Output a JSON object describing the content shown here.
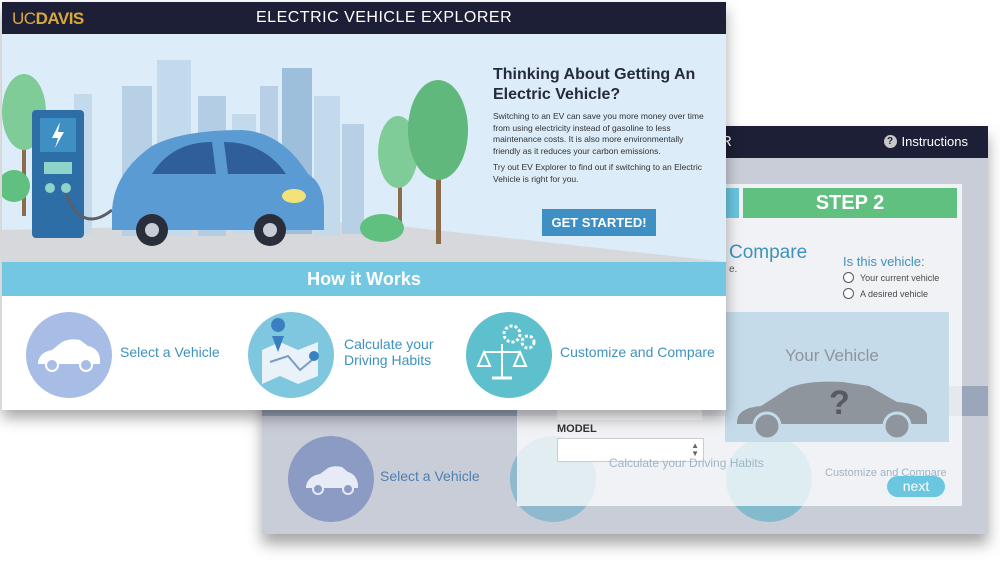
{
  "back_window": {
    "title_fragment": "ER",
    "instructions_label": "Instructions",
    "step2_label": "STEP 2",
    "compare_fragment": "Compare",
    "compare_tail": "e.",
    "is_this_vehicle": "Is this vehicle:",
    "radio_options": [
      "Your current vehicle",
      "A desired vehicle"
    ],
    "your_vehicle": "Your Vehicle",
    "model_label": "MODEL",
    "next_label": "next",
    "steps": [
      "Select a Vehicle",
      "Calculate your\nDriving Habits",
      "Customize and Compare"
    ]
  },
  "front_window": {
    "logo_uc": "UC",
    "logo_davis": "DAVIS",
    "app_title": "ELECTRIC VEHICLE EXPLORER",
    "hero_title": "Thinking About Getting An Electric Vehicle?",
    "hero_p1": "Switching to an EV can save you more money over time from using electricity instead of gasoline to less maintenance costs. It is also more environmentally friendly as it reduces your carbon emissions.",
    "hero_p2": "Try out EV Explorer to find out if switching to an Electric Vehicle is right for you.",
    "cta_label": "GET STARTED!",
    "how_it_works": "How it Works",
    "steps": [
      {
        "label": "Select a Vehicle",
        "icon": "car-icon"
      },
      {
        "label": "Calculate your\nDriving Habits",
        "icon": "map-pin-icon"
      },
      {
        "label": "Customize and Compare",
        "icon": "scales-gears-icon"
      }
    ]
  },
  "colors": {
    "header_bg": "#1d1f36",
    "accent_blue": "#74c7e2",
    "cta_blue": "#3d8fc4",
    "step2_green": "#5fc080",
    "logo_gold": "#d8a93a"
  }
}
